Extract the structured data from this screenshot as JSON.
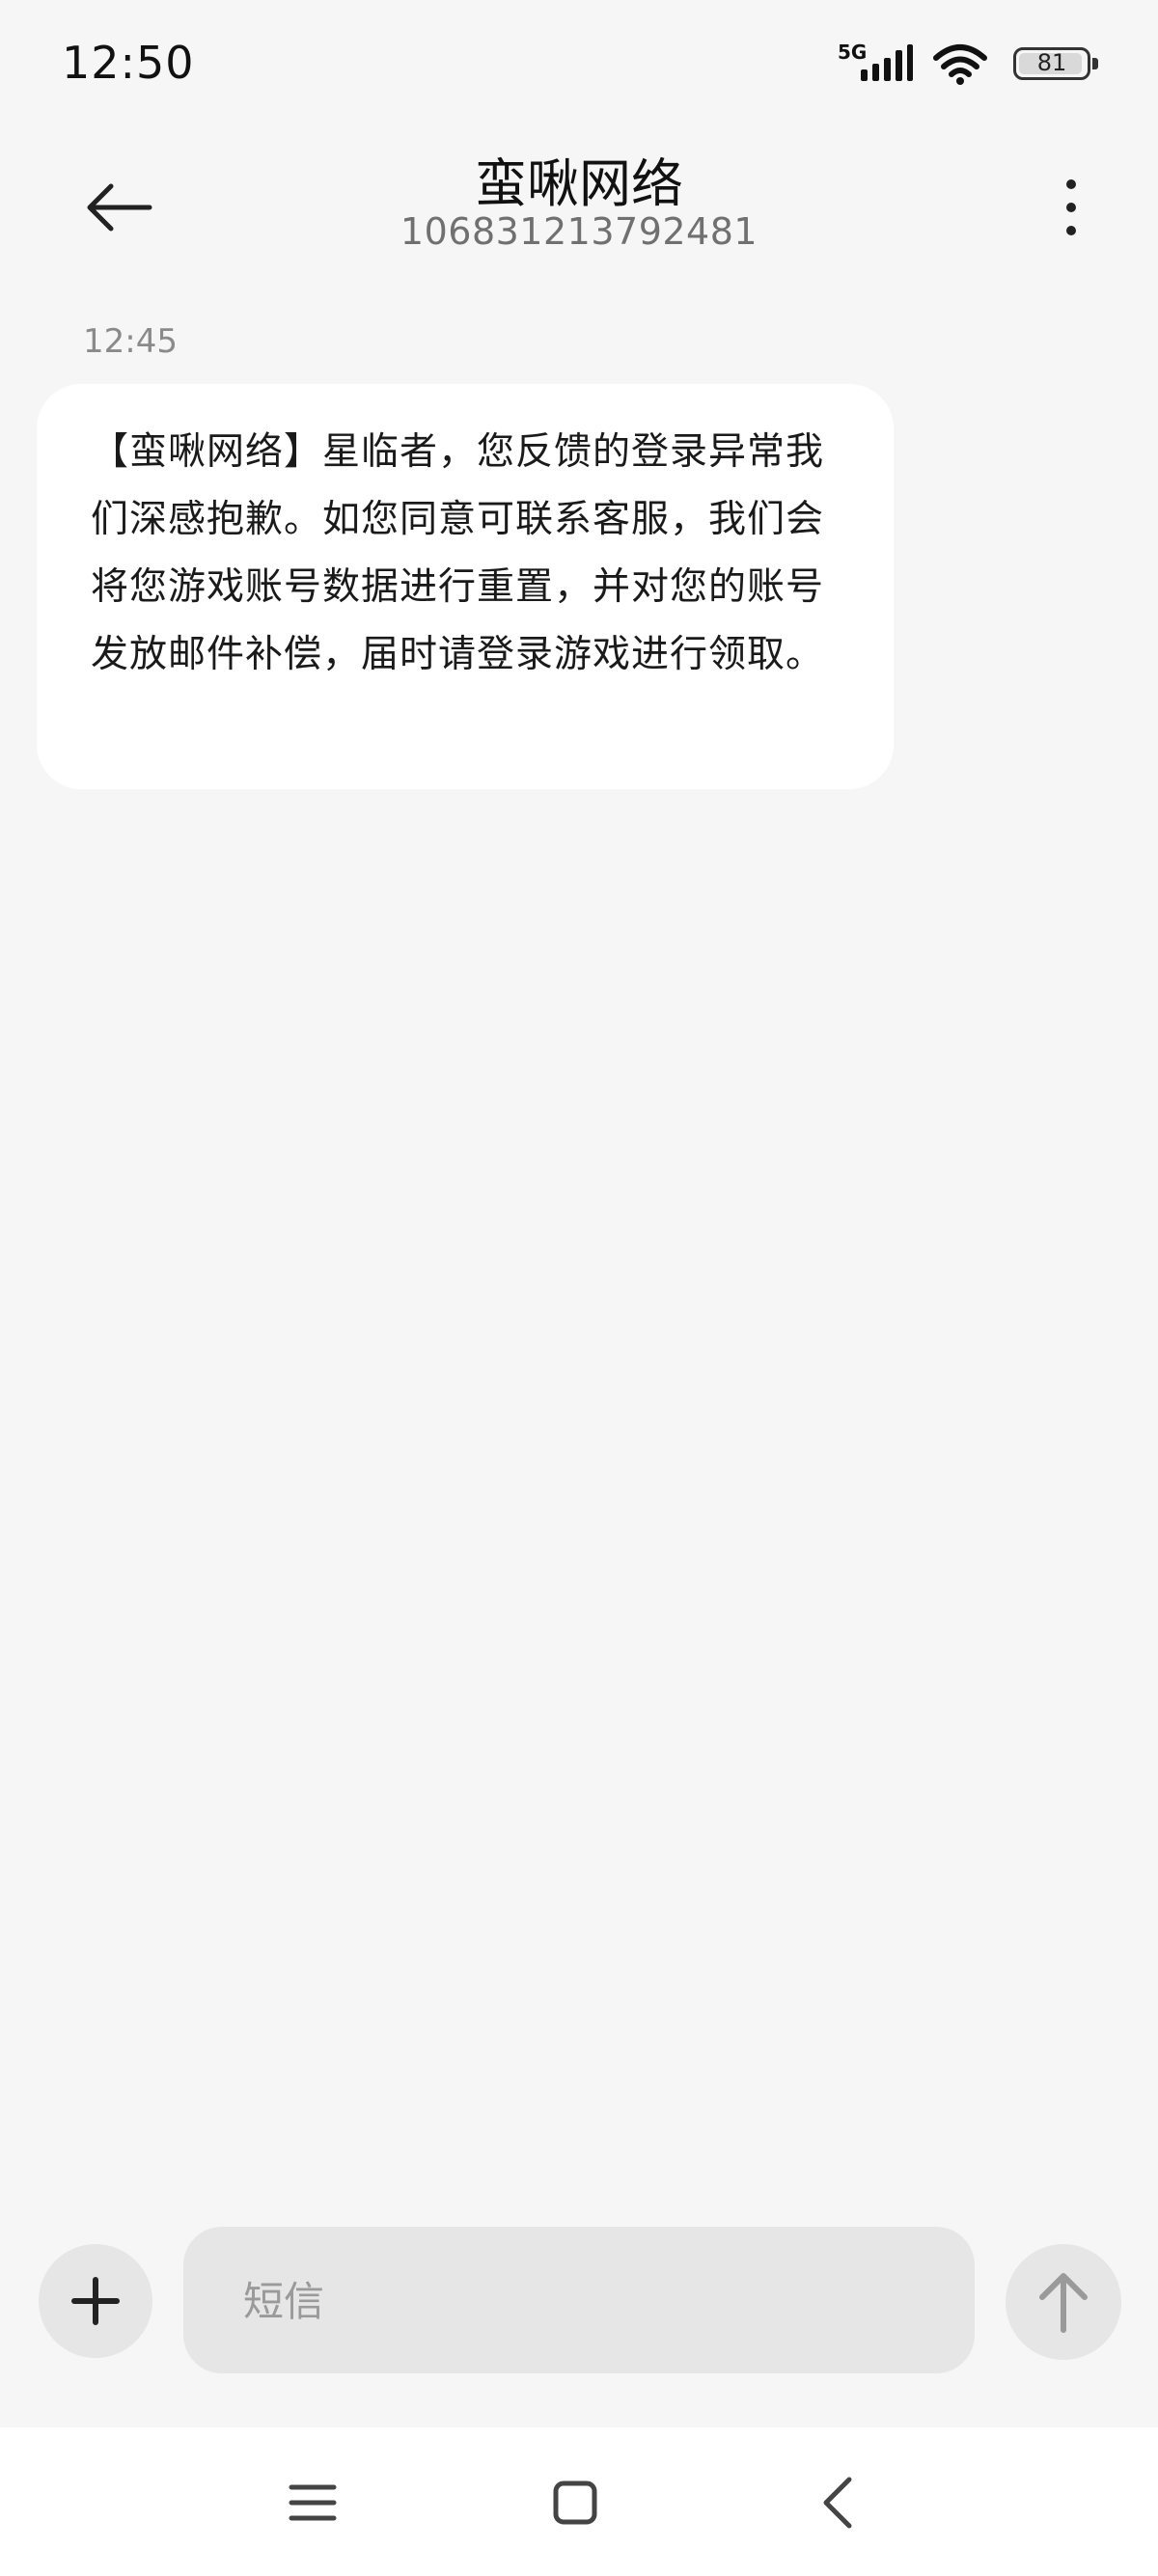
{
  "status_bar": {
    "time": "12:50",
    "network": "5G",
    "battery_level": "81"
  },
  "header": {
    "title": "蛮啾网络",
    "subtitle": "106831213792481"
  },
  "conversation": {
    "timestamp": "12:45",
    "message": "【蛮啾网络】星临者，您反馈的登录异常我们深感抱歉。如您同意可联系客服，我们会将您游戏账号数据进行重置，并对您的账号发放邮件补偿，届时请登录游戏进行领取。"
  },
  "input": {
    "placeholder": "短信"
  },
  "icons": {
    "back": "arrow-left-icon",
    "more": "more-vertical-icon",
    "add": "plus-icon",
    "send": "arrow-up-icon",
    "menu": "menu-icon",
    "home": "home-square-icon",
    "nav_back": "chevron-left-icon"
  }
}
